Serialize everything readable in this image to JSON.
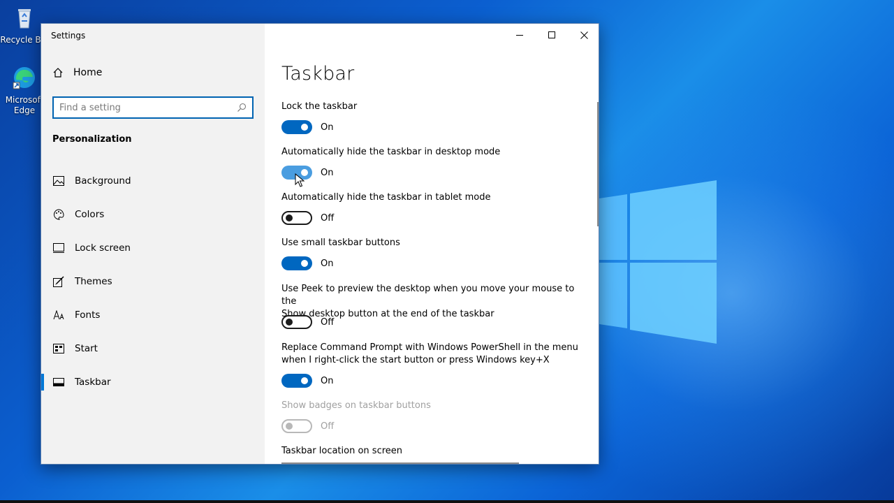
{
  "desktop": {
    "icons": [
      {
        "label": "Recycle Bin",
        "icon": "recycle-bin-icon"
      },
      {
        "label": "Microsoft Edge",
        "icon": "edge-icon"
      }
    ]
  },
  "window": {
    "title": "Settings",
    "controls": [
      "minimize-icon",
      "maximize-icon",
      "close-icon"
    ]
  },
  "sidebar": {
    "home_label": "Home",
    "search_placeholder": "Find a setting",
    "section": "Personalization",
    "items": [
      {
        "label": "Background",
        "icon": "picture-icon"
      },
      {
        "label": "Colors",
        "icon": "palette-icon"
      },
      {
        "label": "Lock screen",
        "icon": "lock-screen-icon"
      },
      {
        "label": "Themes",
        "icon": "brush-icon"
      },
      {
        "label": "Fonts",
        "icon": "font-icon"
      },
      {
        "label": "Start",
        "icon": "start-icon"
      },
      {
        "label": "Taskbar",
        "icon": "taskbar-icon",
        "active": true
      }
    ]
  },
  "main": {
    "title": "Taskbar",
    "settings": [
      {
        "label": "Lock the taskbar",
        "state": "On"
      },
      {
        "label": "Automatically hide the taskbar in desktop mode",
        "state": "On"
      },
      {
        "label": "Automatically hide the taskbar in tablet mode",
        "state": "Off"
      },
      {
        "label": "Use small taskbar buttons",
        "state": "On"
      },
      {
        "label_line1": "Use Peek to preview the desktop when you move your mouse to the",
        "label_line2": "Show desktop button at the end of the taskbar",
        "state": "Off"
      },
      {
        "label_line1": "Replace Command Prompt with Windows PowerShell in the menu",
        "label_line2": "when I right-click the start button or press Windows key+X",
        "state": "On"
      },
      {
        "label": "Show badges on taskbar buttons",
        "state": "Off",
        "disabled": true
      },
      {
        "label": "Taskbar location on screen"
      }
    ]
  },
  "colors": {
    "accent": "#0067c0",
    "sidebar_bg": "#f2f2f2",
    "desktop_blue": "#0b5fd0"
  }
}
